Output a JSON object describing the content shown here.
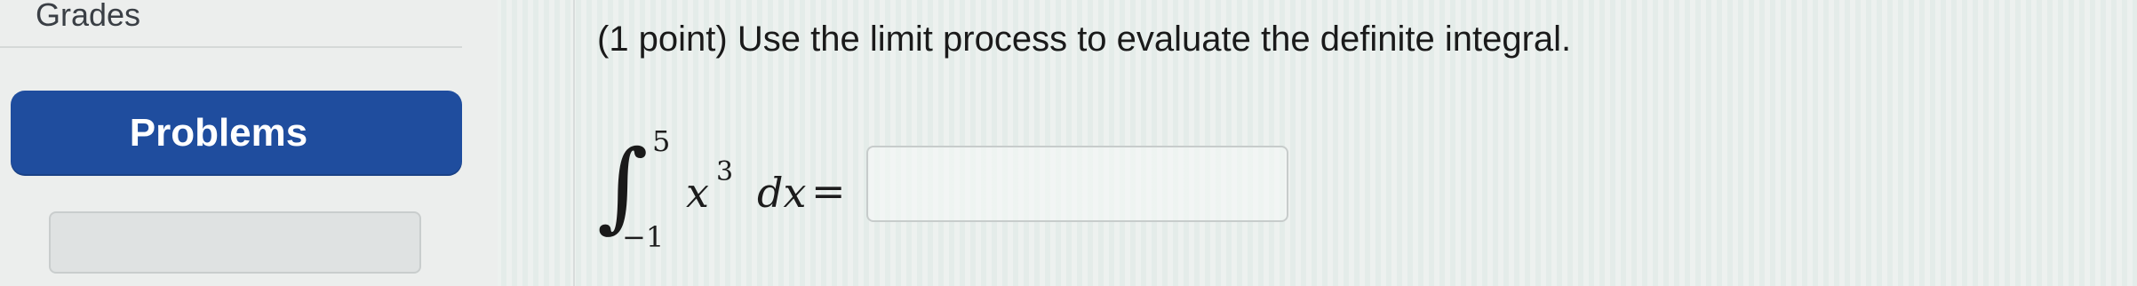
{
  "sidebar": {
    "grades_label": "Grades",
    "problems_label": "Problems"
  },
  "problem": {
    "prompt": "(1 point) Use the limit process to evaluate the definite integral.",
    "integral": {
      "sign": "∫",
      "upper_limit": "5",
      "lower_limit": "−1",
      "integrand_base": "x",
      "integrand_exponent": "3",
      "differential": "dx",
      "equals": "="
    },
    "answer_value": ""
  }
}
